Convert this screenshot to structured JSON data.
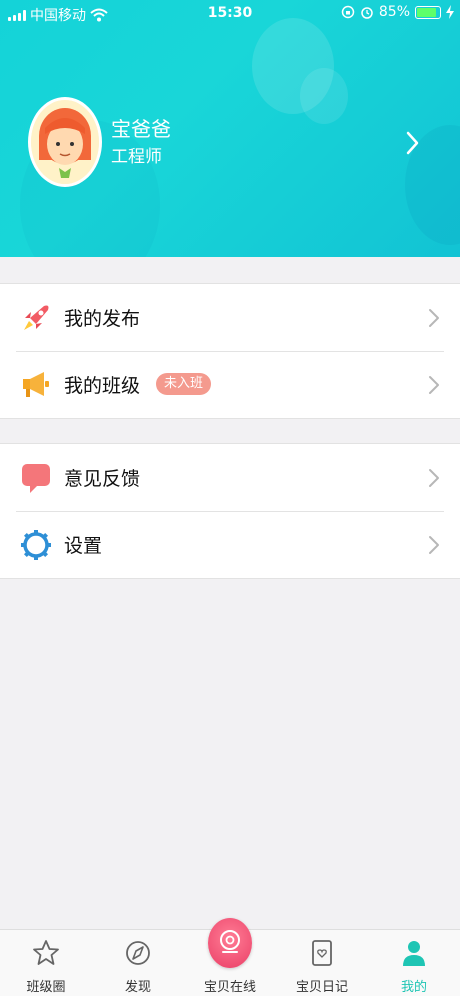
{
  "status_bar": {
    "carrier": "中国移动",
    "time": "15:30",
    "battery": "85%",
    "battery_level": 0.85
  },
  "profile": {
    "name": "宝爸爸",
    "title": "工程师"
  },
  "menu_group_1": [
    {
      "label": "我的发布",
      "icon": "rocket-icon"
    },
    {
      "label": "我的班级",
      "icon": "megaphone-icon",
      "badge": "未入班"
    }
  ],
  "menu_group_2": [
    {
      "label": "意见反馈",
      "icon": "chat-bubble-icon"
    },
    {
      "label": "设置",
      "icon": "gear-icon"
    }
  ],
  "tabbar": {
    "items": [
      {
        "label": "班级圈",
        "icon": "star-icon"
      },
      {
        "label": "发现",
        "icon": "compass-icon"
      },
      {
        "label": "宝贝在线",
        "icon": "camera-icon"
      },
      {
        "label": "宝贝日记",
        "icon": "diary-icon"
      },
      {
        "label": "我的",
        "icon": "person-icon"
      }
    ],
    "active_index": 4
  },
  "colors": {
    "header": "#19d6d8",
    "accent": "#1fc5b4",
    "badge": "#f49a8e"
  }
}
